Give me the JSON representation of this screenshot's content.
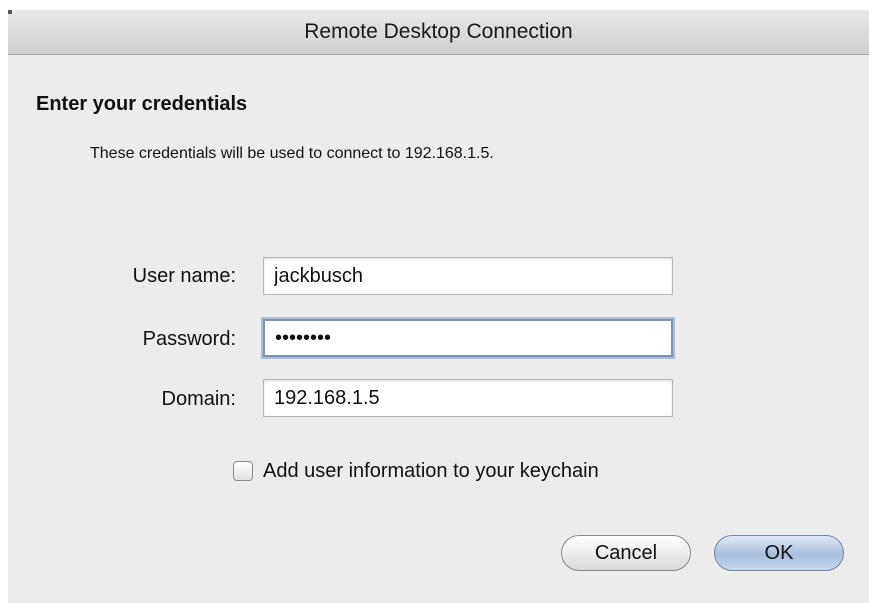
{
  "window": {
    "title": "Remote Desktop Connection"
  },
  "dialog": {
    "heading": "Enter your credentials",
    "description": "These credentials will be used to connect to 192.168.1.5."
  },
  "form": {
    "username": {
      "label": "User name:",
      "value": "jackbusch"
    },
    "password": {
      "label": "Password:",
      "value": "••••••••"
    },
    "domain": {
      "label": "Domain:",
      "value": "192.168.1.5"
    },
    "keychain": {
      "label": "Add user information to your keychain",
      "checked": false
    }
  },
  "buttons": {
    "cancel_label": "Cancel",
    "ok_label": "OK"
  }
}
